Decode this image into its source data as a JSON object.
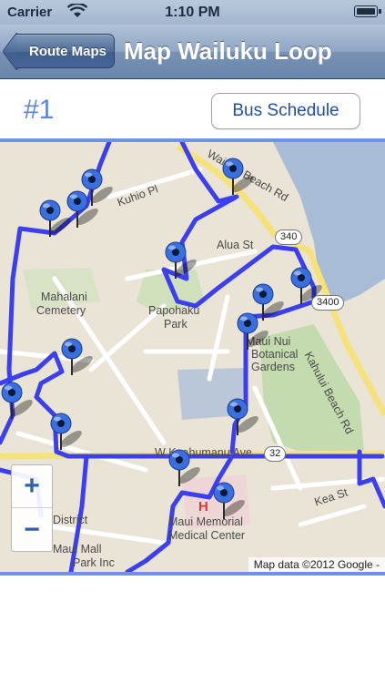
{
  "status_bar": {
    "carrier": "Carrier",
    "time": "1:10 PM"
  },
  "nav": {
    "back_label": "Route Maps",
    "title": "Map Wailuku Loop"
  },
  "header": {
    "route_number": "#1",
    "schedule_label": "Bus Schedule"
  },
  "map": {
    "labels": {
      "kuhio_pl": "Kuhio Pl",
      "beach_rd": "Waiehu Beach Rd",
      "alua_st": "Alua St",
      "mahalani": "Mahalani",
      "cemetery": "Cemetery",
      "papohaku": "Papohaku",
      "park": "Park",
      "maui_nui": "Maui Nui",
      "botanical": "Botanical",
      "gardens": "Gardens",
      "kahului_beach_rd": "Kahului Beach Rd",
      "kaahumanu_ave": "W Kaahumanu Ave",
      "kea_st": "Kea St",
      "district": "District",
      "maui_memorial": "Maui Memorial",
      "medical_center": "Medical Center",
      "maui_mall_park": "Maui Mall",
      "park_inc": "Park Inc",
      "hospital_h": "H"
    },
    "shields": {
      "r340a": "340",
      "r340b": "3400",
      "r32": "32"
    },
    "zoom_in": "+",
    "zoom_out": "−",
    "attribution": "Map data ©2012 Google -",
    "colors": {
      "route": "#3c3ff0",
      "pin": "#3a6fe0",
      "accent": "#6f92e6"
    }
  }
}
